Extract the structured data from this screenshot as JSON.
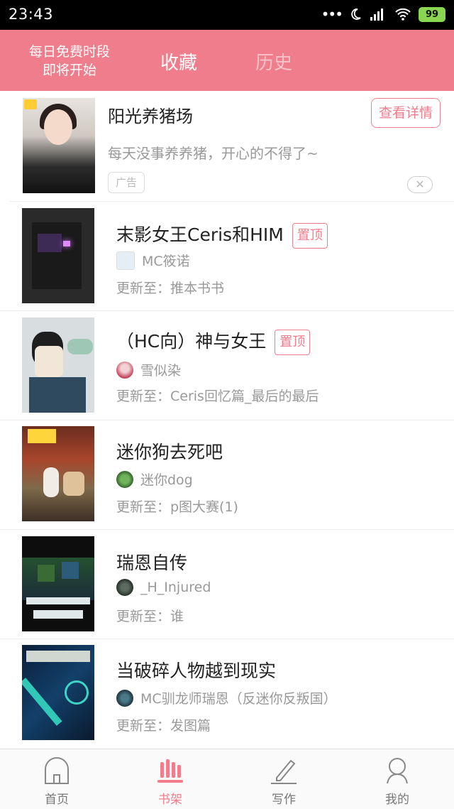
{
  "status_bar": {
    "time": "23:43",
    "battery": "99"
  },
  "header": {
    "promo_line1": "每日免费时段",
    "promo_line2": "即将开始",
    "tab_favorites": "收藏",
    "tab_history": "历史"
  },
  "ad": {
    "title": "阳光养猪场",
    "description": "每天没事养养猪，开心的不得了~",
    "badge": "广告",
    "detail_button": "查看详情"
  },
  "books": [
    {
      "title": "末影女王Ceris和HIM",
      "pinned": "置顶",
      "author": "MC筱诺",
      "update": "更新至：推本书书"
    },
    {
      "title": "（HC向）神与女王",
      "pinned": "置顶",
      "author": "雪似染",
      "update": "更新至：Ceris回忆篇_最后的最后"
    },
    {
      "title": "迷你狗去死吧",
      "pinned": "",
      "author": "迷你dog",
      "update": "更新至：p图大赛(1)"
    },
    {
      "title": "瑞恩自传",
      "pinned": "",
      "author": "_H_Injured",
      "update": "更新至：谁"
    },
    {
      "title": "当破碎人物越到现实",
      "pinned": "",
      "author": "MC驯龙师瑞恩（反迷你反叛国）",
      "update": "更新至：发图篇"
    }
  ],
  "bottom_nav": [
    {
      "label": "首页",
      "icon": "home-icon"
    },
    {
      "label": "书架",
      "icon": "bookshelf-icon"
    },
    {
      "label": "写作",
      "icon": "pen-icon"
    },
    {
      "label": "我的",
      "icon": "profile-icon"
    }
  ],
  "colors": {
    "accent": "#f07d8c",
    "accent_light": "#f8c2c9"
  }
}
